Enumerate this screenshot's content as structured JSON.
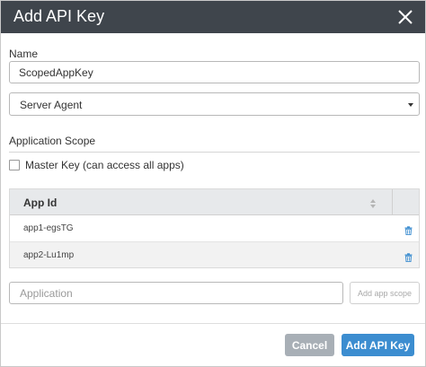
{
  "dialog": {
    "title": "Add API Key",
    "close_icon": "close-icon"
  },
  "form": {
    "name_label": "Name",
    "name_value": "ScopedAppKey",
    "key_type": "Server Agent",
    "key_type_icon": "caret-down-icon"
  },
  "scope": {
    "title": "Application Scope",
    "master_key_label": "Master Key (can access all apps)",
    "master_key_checked": false,
    "table_header": "App Id",
    "sort_icon": "sort-icon",
    "delete_icon": "trash-icon",
    "apps": [
      "app1-egsTG",
      "app2-Lu1mp"
    ],
    "app_placeholder": "Application",
    "add_scope_label": "Add app scope"
  },
  "footer": {
    "cancel_label": "Cancel",
    "submit_label": "Add API Key"
  },
  "colors": {
    "titlebar": "#3f454c",
    "primary": "#3c8dd0",
    "secondary": "#a8afb6",
    "table_header": "#e7e9eb",
    "trash_icon": "#3c8dd0"
  }
}
